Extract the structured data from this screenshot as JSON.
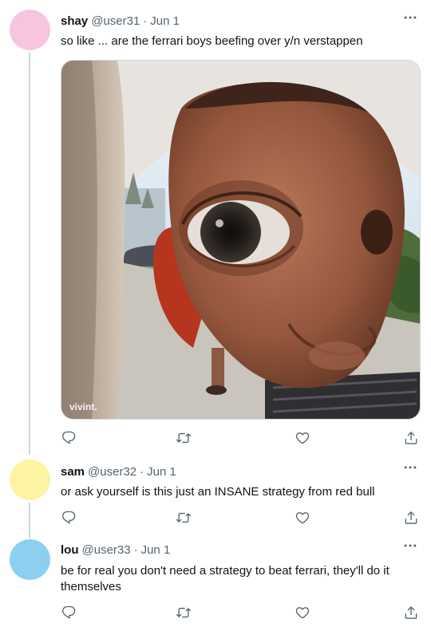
{
  "tweets": [
    {
      "name": "shay",
      "handle": "@user31",
      "sep": "·",
      "date": "Jun 1",
      "text": "so like ... are the ferrari boys beefing over y/n verstappen",
      "avatar_color": "#f7c5df",
      "media": {
        "watermark": "vivint."
      }
    },
    {
      "name": "sam",
      "handle": "@user32",
      "sep": "·",
      "date": "Jun 1",
      "text": "or ask yourself is this just an INSANE strategy from red bull",
      "avatar_color": "#fdf3a3"
    },
    {
      "name": "lou",
      "handle": "@user33",
      "sep": "·",
      "date": "Jun 1",
      "text": "be for real you don't need a strategy to beat ferrari, they'll do it themselves",
      "avatar_color": "#8ccff1"
    }
  ],
  "icons": {
    "more": "more-icon",
    "reply": "reply-icon",
    "retweet": "retweet-icon",
    "like": "like-icon",
    "share": "share-icon"
  },
  "colors": {
    "text": "#0f1419",
    "secondary": "#536471",
    "thread_line": "#cfd9de"
  }
}
